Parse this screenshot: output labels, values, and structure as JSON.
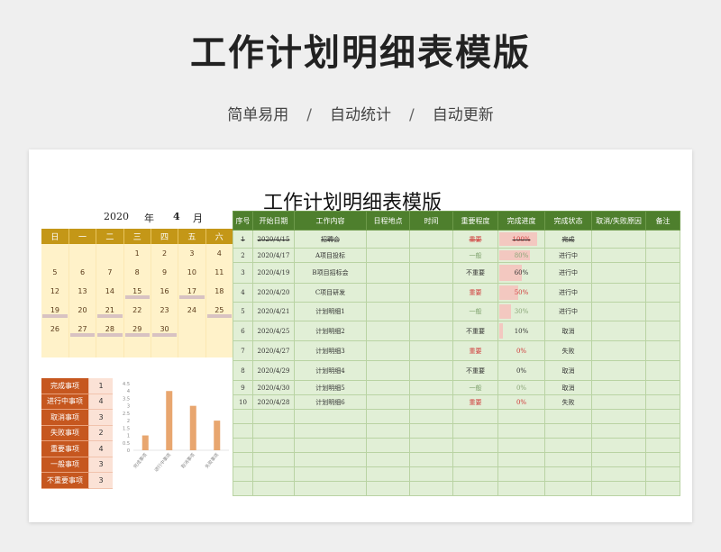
{
  "page_title": "工作计划明细表模版",
  "subtitle": {
    "items": [
      "简单易用",
      "自动统计",
      "自动更新"
    ],
    "separator": "/"
  },
  "sheet_title": "工作计划明细表模版",
  "calendar": {
    "year": "2020",
    "year_label": "年",
    "month": "4",
    "month_label": "月",
    "weekdays": [
      "日",
      "一",
      "二",
      "三",
      "四",
      "五",
      "六"
    ],
    "weeks": [
      [
        "",
        "",
        "",
        "1",
        "2",
        "3",
        "4"
      ],
      [
        "5",
        "6",
        "7",
        "8",
        "9",
        "10",
        "11"
      ],
      [
        "12",
        "13",
        "14",
        "15",
        "16",
        "17",
        "18"
      ],
      [
        "19",
        "20",
        "21",
        "22",
        "23",
        "24",
        "25"
      ],
      [
        "26",
        "27",
        "28",
        "29",
        "30",
        "",
        ""
      ],
      [
        "",
        "",
        "",
        "",
        "",
        "",
        ""
      ]
    ],
    "marked_days": [
      "15",
      "17",
      "19",
      "21",
      "25",
      "27",
      "28",
      "29",
      "30"
    ]
  },
  "summary": [
    {
      "label": "完成事项",
      "value": "1"
    },
    {
      "label": "进行中事项",
      "value": "4"
    },
    {
      "label": "取消事项",
      "value": "3"
    },
    {
      "label": "失败事项",
      "value": "2"
    },
    {
      "label": "重要事项",
      "value": "4"
    },
    {
      "label": "一般事项",
      "value": "3"
    },
    {
      "label": "不重要事项",
      "value": "3"
    }
  ],
  "chart_data": {
    "type": "bar",
    "categories": [
      "完成事项",
      "进行中事项",
      "取消事项",
      "失败事项"
    ],
    "values": [
      1,
      4,
      3,
      2
    ],
    "ylim": [
      0,
      4.5
    ],
    "yticks": [
      "0",
      "0.5",
      "1",
      "1.5",
      "2",
      "2.5",
      "3",
      "3.5",
      "4",
      "4.5"
    ],
    "color": "#e8a66f",
    "title": "",
    "xlabel": "",
    "ylabel": ""
  },
  "table": {
    "headers": [
      "序号",
      "开始日期",
      "工作内容",
      "日程地点",
      "时间",
      "重要程度",
      "完成进度",
      "完成状态",
      "取消/失败原因",
      "备注"
    ],
    "rows": [
      {
        "no": "1",
        "date": "2020/4/15",
        "content": "招聘会",
        "place": "",
        "time": "",
        "importance": "重要",
        "progress": "100%",
        "progress_value": 1.0,
        "status": "完成",
        "reason": "",
        "note": ""
      },
      {
        "no": "2",
        "date": "2020/4/17",
        "content": "A项目投标",
        "place": "",
        "time": "",
        "importance": "一般",
        "progress": "80%",
        "progress_value": 0.8,
        "status": "进行中",
        "reason": "",
        "note": ""
      },
      {
        "no": "3",
        "date": "2020/4/19",
        "content": "B项目招标会",
        "place": "",
        "time": "",
        "importance": "不重要",
        "progress": "60%",
        "progress_value": 0.6,
        "status": "进行中",
        "reason": "",
        "note": ""
      },
      {
        "no": "4",
        "date": "2020/4/20",
        "content": "C项目研发",
        "place": "",
        "time": "",
        "importance": "重要",
        "progress": "50%",
        "progress_value": 0.5,
        "status": "进行中",
        "reason": "",
        "note": ""
      },
      {
        "no": "5",
        "date": "2020/4/21",
        "content": "计划明细1",
        "place": "",
        "time": "",
        "importance": "一般",
        "progress": "30%",
        "progress_value": 0.3,
        "status": "进行中",
        "reason": "",
        "note": ""
      },
      {
        "no": "6",
        "date": "2020/4/25",
        "content": "计划明细2",
        "place": "",
        "time": "",
        "importance": "不重要",
        "progress": "10%",
        "progress_value": 0.1,
        "status": "取消",
        "reason": "",
        "note": ""
      },
      {
        "no": "7",
        "date": "2020/4/27",
        "content": "计划明细3",
        "place": "",
        "time": "",
        "importance": "重要",
        "progress": "0%",
        "progress_value": 0,
        "status": "失败",
        "reason": "",
        "note": ""
      },
      {
        "no": "8",
        "date": "2020/4/29",
        "content": "计划明细4",
        "place": "",
        "time": "",
        "importance": "不重要",
        "progress": "0%",
        "progress_value": 0,
        "status": "取消",
        "reason": "",
        "note": ""
      },
      {
        "no": "9",
        "date": "2020/4/30",
        "content": "计划明细5",
        "place": "",
        "time": "",
        "importance": "一般",
        "progress": "0%",
        "progress_value": 0,
        "status": "取消",
        "reason": "",
        "note": ""
      },
      {
        "no": "10",
        "date": "2020/4/28",
        "content": "计划明细6",
        "place": "",
        "time": "",
        "importance": "重要",
        "progress": "0%",
        "progress_value": 0,
        "status": "失败",
        "reason": "",
        "note": ""
      }
    ],
    "empty_rows": 6
  }
}
